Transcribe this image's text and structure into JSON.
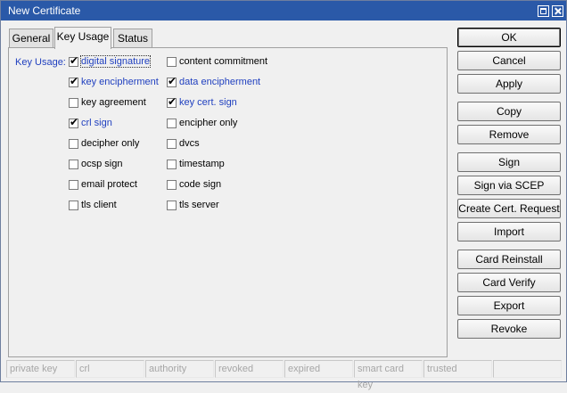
{
  "window": {
    "title": "New Certificate"
  },
  "tabs": [
    {
      "label": "General",
      "active": false
    },
    {
      "label": "Key Usage",
      "active": true
    },
    {
      "label": "Status",
      "active": false
    }
  ],
  "key_usage": {
    "label": "Key Usage:",
    "left": [
      {
        "label": "digital signature",
        "checked": true
      },
      {
        "label": "key encipherment",
        "checked": true
      },
      {
        "label": "key agreement",
        "checked": false
      },
      {
        "label": "crl sign",
        "checked": true
      },
      {
        "label": "decipher only",
        "checked": false
      },
      {
        "label": "ocsp sign",
        "checked": false
      },
      {
        "label": "email protect",
        "checked": false
      },
      {
        "label": "tls client",
        "checked": false
      }
    ],
    "right": [
      {
        "label": "content commitment",
        "checked": false
      },
      {
        "label": "data encipherment",
        "checked": true
      },
      {
        "label": "key cert. sign",
        "checked": true
      },
      {
        "label": "encipher only",
        "checked": false
      },
      {
        "label": "dvcs",
        "checked": false
      },
      {
        "label": "timestamp",
        "checked": false
      },
      {
        "label": "code sign",
        "checked": false
      },
      {
        "label": "tls server",
        "checked": false
      }
    ]
  },
  "buttons": {
    "ok": "OK",
    "cancel": "Cancel",
    "apply": "Apply",
    "copy": "Copy",
    "remove": "Remove",
    "sign": "Sign",
    "sign_scep": "Sign via SCEP",
    "create_request": "Create Cert. Request",
    "import": "Import",
    "card_reinstall": "Card Reinstall",
    "card_verify": "Card Verify",
    "export": "Export",
    "revoke": "Revoke"
  },
  "status_bar": [
    "private key",
    "crl",
    "authority",
    "revoked",
    "expired",
    "smart card key",
    "trusted",
    ""
  ],
  "colors": {
    "title_bar": "#2a59a8",
    "active_label": "#1f3fbf"
  }
}
